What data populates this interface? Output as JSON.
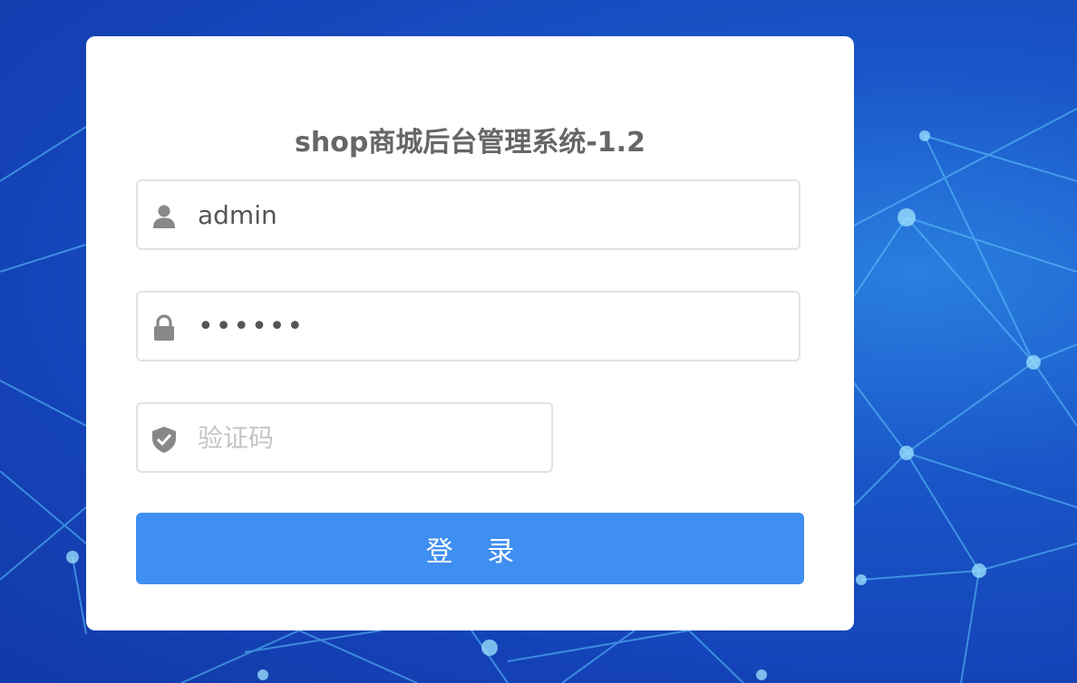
{
  "page": {
    "title": "shop商城后台管理系统-1.2"
  },
  "form": {
    "username": {
      "value": "admin",
      "icon": "user-icon"
    },
    "password": {
      "value": "••••••",
      "icon": "lock-icon"
    },
    "captcha": {
      "value": "",
      "placeholder": "验证码",
      "icon": "shield-check-icon"
    },
    "submit_label": "登 录"
  },
  "colors": {
    "background": "#1a56c8",
    "button": "#3f8ef1",
    "icon": "#888888",
    "title": "#666666"
  }
}
